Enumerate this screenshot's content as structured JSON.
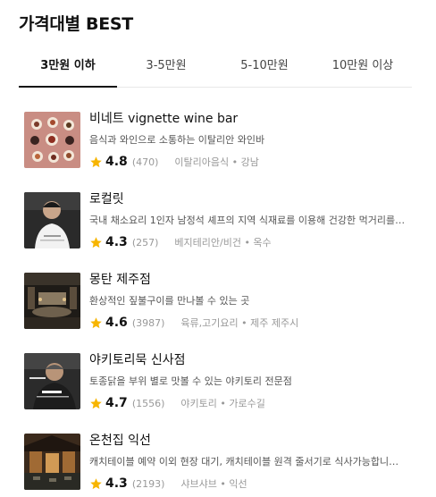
{
  "section_title": "가격대별 BEST",
  "tabs": [
    {
      "label": "3만원 이하",
      "active": true
    },
    {
      "label": "3-5만원",
      "active": false
    },
    {
      "label": "5-10만원",
      "active": false
    },
    {
      "label": "10만원 이상",
      "active": false
    }
  ],
  "restaurants": [
    {
      "name": "비네트 vignette wine bar",
      "description": "음식과 와인으로 소통하는 이탈리안 와인바",
      "rating": "4.8",
      "reviews": "(470)",
      "category": "이탈리아음식 • 강남",
      "thumb_icon": "food-plates-image"
    },
    {
      "name": "로컬릿",
      "description": "국내 채소요리 1인자 남정석 셰프의 지역 식재료를 이용해 건강한 먹거리를 제공...",
      "rating": "4.3",
      "reviews": "(257)",
      "category": "베지테리안/비건 • 옥수",
      "thumb_icon": "chef-portrait-image"
    },
    {
      "name": "몽탄 제주점",
      "description": "환상적인 짚불구이를 만나볼 수 있는 곳",
      "rating": "4.6",
      "reviews": "(3987)",
      "category": "육류,고기요리 • 제주 제주시",
      "thumb_icon": "restaurant-interior-image"
    },
    {
      "name": "야키토리묵 신사점",
      "description": "토종닭을 부위 별로 맛볼 수 있는 야키토리 전문점",
      "rating": "4.7",
      "reviews": "(1556)",
      "category": "야키토리 • 가로수길",
      "thumb_icon": "chef-portrait-image"
    },
    {
      "name": "온천집 익선",
      "description": "캐치테이블 예약 이외 현장 대기, 캐치테이블 원격 줄서기로 식사가능합니다.캐...",
      "rating": "4.3",
      "reviews": "(2193)",
      "category": "샤브샤브 • 익선",
      "thumb_icon": "courtyard-image"
    }
  ],
  "colors": {
    "star": "#f7b500",
    "active_tab_underline": "#111111"
  }
}
